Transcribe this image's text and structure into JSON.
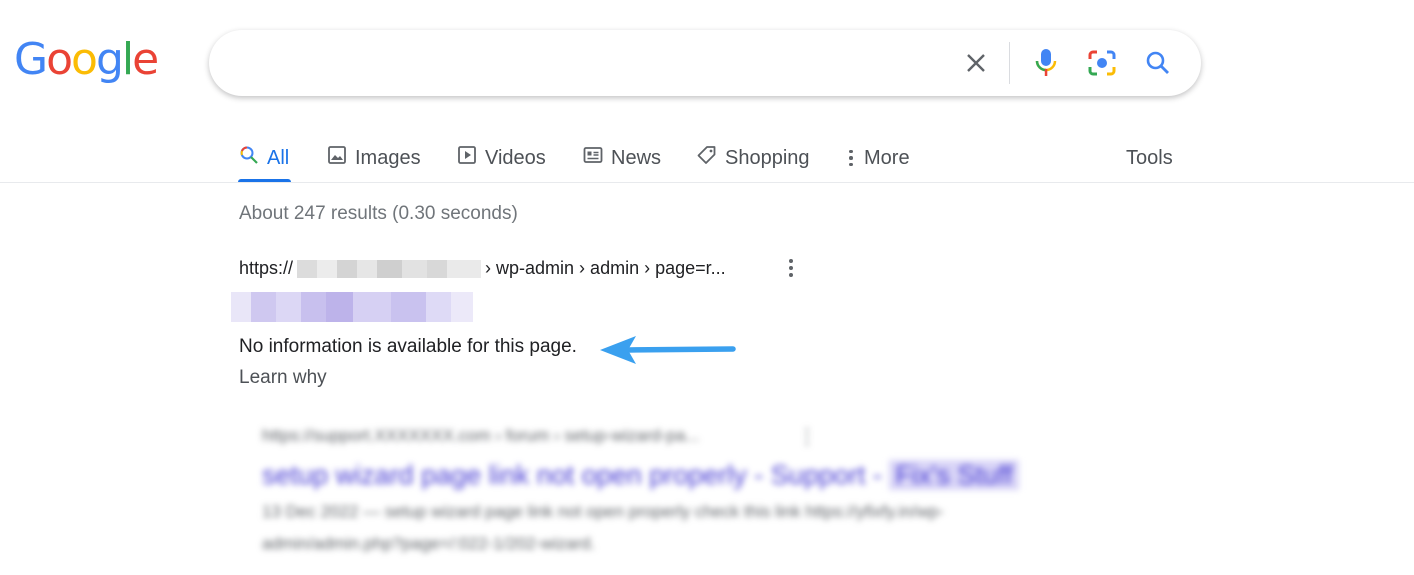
{
  "logo": {
    "letters": [
      "G",
      "o",
      "o",
      "g",
      "l",
      "e"
    ],
    "colors": [
      "#4285F4",
      "#EA4335",
      "#FBBC05",
      "#4285F4",
      "#34A853",
      "#EA4335"
    ]
  },
  "search": {
    "placeholder": ""
  },
  "search_icons": [
    "close-icon",
    "microphone-icon",
    "camera-lens-icon",
    "search-icon"
  ],
  "tabs": [
    {
      "label": "All",
      "icon": "search-icon",
      "active": true
    },
    {
      "label": "Images",
      "icon": "image-icon"
    },
    {
      "label": "Videos",
      "icon": "play-icon"
    },
    {
      "label": "News",
      "icon": "news-icon"
    },
    {
      "label": "Shopping",
      "icon": "tag-icon"
    },
    {
      "label": "More",
      "icon": "kebab-icon"
    }
  ],
  "tools_label": "Tools",
  "stats": "About 247 results (0.30 seconds)",
  "result": {
    "url_prefix": "https://",
    "url_suffix": "› wp-admin › admin › page=r...",
    "snippet": "No information is available for this page.",
    "learn_why": "Learn why"
  },
  "blurred_result": {
    "url": "https://support.XXXXXXX.com › forum › setup-wizard-pa...",
    "title": "setup wizard page link not open properly - Support -",
    "title_chip": "Fix's Stuff",
    "snippet_line1": "13 Dec 2022 — setup wizard page link not open properly check this link https://yfixfy.in/wp-",
    "snippet_line2": "admin/admin.php?page=/:022-1/202-wizard."
  },
  "colors": {
    "accent": "#1a73e8",
    "arrow": "#3aa0ef",
    "link_visited": "#681da8"
  }
}
